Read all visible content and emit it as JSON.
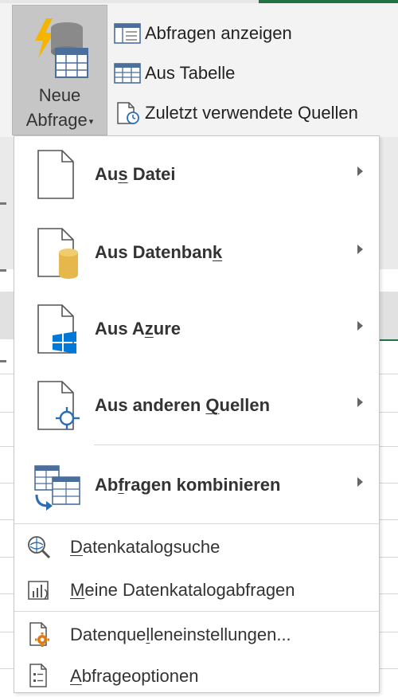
{
  "ribbon": {
    "new_query": {
      "line1": "Neue",
      "line2": "Abfrage"
    },
    "items": [
      {
        "label": "Abfragen anzeigen",
        "icon": "show-queries-icon"
      },
      {
        "label": "Aus Tabelle",
        "icon": "table-icon"
      },
      {
        "label": "Zuletzt verwendete Quellen",
        "icon": "recent-sources-icon"
      }
    ]
  },
  "menu": {
    "big_items": [
      {
        "pre": "Au",
        "key": "s",
        "post": " Datei",
        "icon": "file-icon"
      },
      {
        "pre": "Aus Datenban",
        "key": "k",
        "post": "",
        "icon": "database-file-icon"
      },
      {
        "pre": "Aus A",
        "key": "z",
        "post": "ure",
        "icon": "azure-file-icon"
      },
      {
        "pre": "Aus anderen ",
        "key": "Q",
        "post": "uellen",
        "icon": "other-sources-file-icon"
      },
      {
        "pre": "Ab",
        "key": "f",
        "post": "ragen kombinieren",
        "icon": "combine-queries-icon"
      }
    ],
    "small_items": [
      {
        "pre": "",
        "key": "D",
        "post": "atenkatalogsuche",
        "icon": "catalog-search-icon"
      },
      {
        "pre": "",
        "key": "M",
        "post": "eine Datenkatalogabfragen",
        "icon": "my-catalog-queries-icon"
      },
      {
        "pre": "Datenque",
        "key": "l",
        "post": "leneinstellungen...",
        "icon": "data-source-settings-icon"
      },
      {
        "pre": "",
        "key": "A",
        "post": "bfrageoptionen",
        "icon": "query-options-icon"
      }
    ]
  },
  "colors": {
    "excel_green": "#217346",
    "azure_blue": "#0078d7",
    "db_gold": "#e6b84c"
  }
}
